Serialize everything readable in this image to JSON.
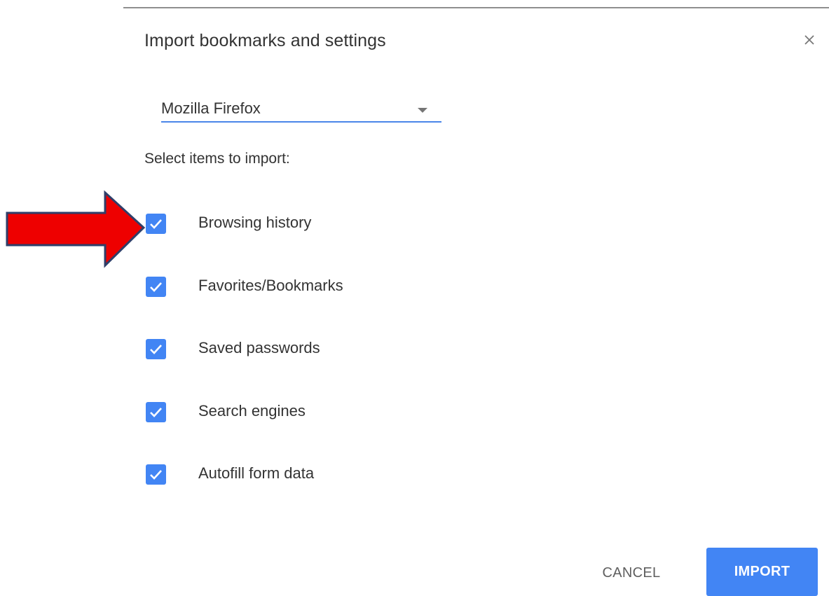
{
  "dialog": {
    "title": "Import bookmarks and settings",
    "close_icon": "close-icon"
  },
  "browser_select": {
    "selected": "Mozilla Firefox",
    "arrow_icon": "dropdown-arrow-icon"
  },
  "items_label": "Select items to import:",
  "items": [
    {
      "label": "Browsing history",
      "checked": true
    },
    {
      "label": "Favorites/Bookmarks",
      "checked": true
    },
    {
      "label": "Saved passwords",
      "checked": true
    },
    {
      "label": "Search engines",
      "checked": true
    },
    {
      "label": "Autofill form data",
      "checked": true
    }
  ],
  "buttons": {
    "cancel": "CANCEL",
    "import": "IMPORT"
  },
  "colors": {
    "accent": "#4285f4",
    "annotation_arrow": "#ee0000"
  }
}
